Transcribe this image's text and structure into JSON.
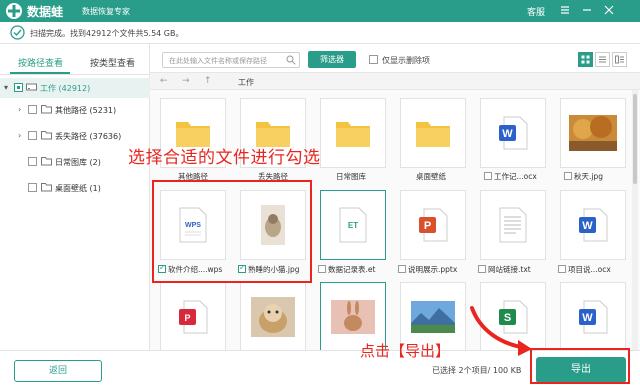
{
  "titlebar": {
    "app_name": "数据蛙",
    "app_subtitle": "数据恢复专家",
    "service": "客服",
    "brand_color": "#2a9d8a"
  },
  "status": {
    "scan_text": "扫描完成。找到42912个文件共5.54 GB。"
  },
  "sidebar": {
    "tabs": [
      {
        "label": "按路径查看",
        "active": true
      },
      {
        "label": "按类型查看",
        "active": false
      }
    ],
    "tree": [
      {
        "label": "工作 (42912)",
        "expanded": true
      },
      {
        "label": "其他路径 (5231)",
        "has_children": true
      },
      {
        "label": "丢失路径 (37636)",
        "has_children": true
      },
      {
        "label": "日常图库 (2)",
        "has_children": false
      },
      {
        "label": "桌面壁纸 (1)",
        "has_children": false
      }
    ]
  },
  "toolbar": {
    "search_placeholder": "在此处输入文件名称或保存路径",
    "filter_label": "筛选器",
    "show_deleted_label": "仅显示删除项"
  },
  "nav": {
    "breadcrumb": "工作"
  },
  "files": [
    {
      "name": "其他路径",
      "icon": "folder-icon",
      "checked": false
    },
    {
      "name": "丢失路径",
      "icon": "folder-icon",
      "checked": false
    },
    {
      "name": "日常图库",
      "icon": "folder-icon",
      "checked": false
    },
    {
      "name": "桌面壁纸",
      "icon": "folder-icon",
      "checked": false
    },
    {
      "name": "工作记...ocx",
      "icon": "word-doc-icon",
      "checked": false
    },
    {
      "name": "秋天.jpg",
      "icon": "autumn-photo-thumbnail",
      "checked": false
    },
    {
      "name": "软件介绍....wps",
      "icon": "wps-doc-icon",
      "checked": true
    },
    {
      "name": "熟睡的小猫.jpg",
      "icon": "sleeping-cat-thumbnail",
      "checked": true
    },
    {
      "name": "数据记录表.et",
      "icon": "et-spreadsheet-icon",
      "checked": false
    },
    {
      "name": "说明展示.pptx",
      "icon": "pptx-icon",
      "checked": false
    },
    {
      "name": "网站链接.txt",
      "icon": "txt-icon",
      "checked": false
    },
    {
      "name": "项目说...ocx",
      "icon": "word-doc-icon",
      "checked": false
    },
    {
      "name": "",
      "icon": "pdf-icon",
      "checked": false
    },
    {
      "name": "",
      "icon": "cat-photo-thumbnail",
      "checked": false
    },
    {
      "name": "",
      "icon": "rabbit-photo-thumbnail",
      "checked": false
    },
    {
      "name": "",
      "icon": "landscape-photo-thumbnail",
      "checked": false
    },
    {
      "name": "",
      "icon": "excel-icon",
      "checked": false
    },
    {
      "name": "",
      "icon": "word-doc-icon",
      "checked": false
    }
  ],
  "annotations": {
    "select_hint": "选择合适的文件进行勾选",
    "export_hint": "点击【导出】",
    "color": "#e8261f"
  },
  "bottom": {
    "back_label": "返回",
    "selected_info": "已选择 2个项目/ 100 KB",
    "export_label": "导出"
  }
}
